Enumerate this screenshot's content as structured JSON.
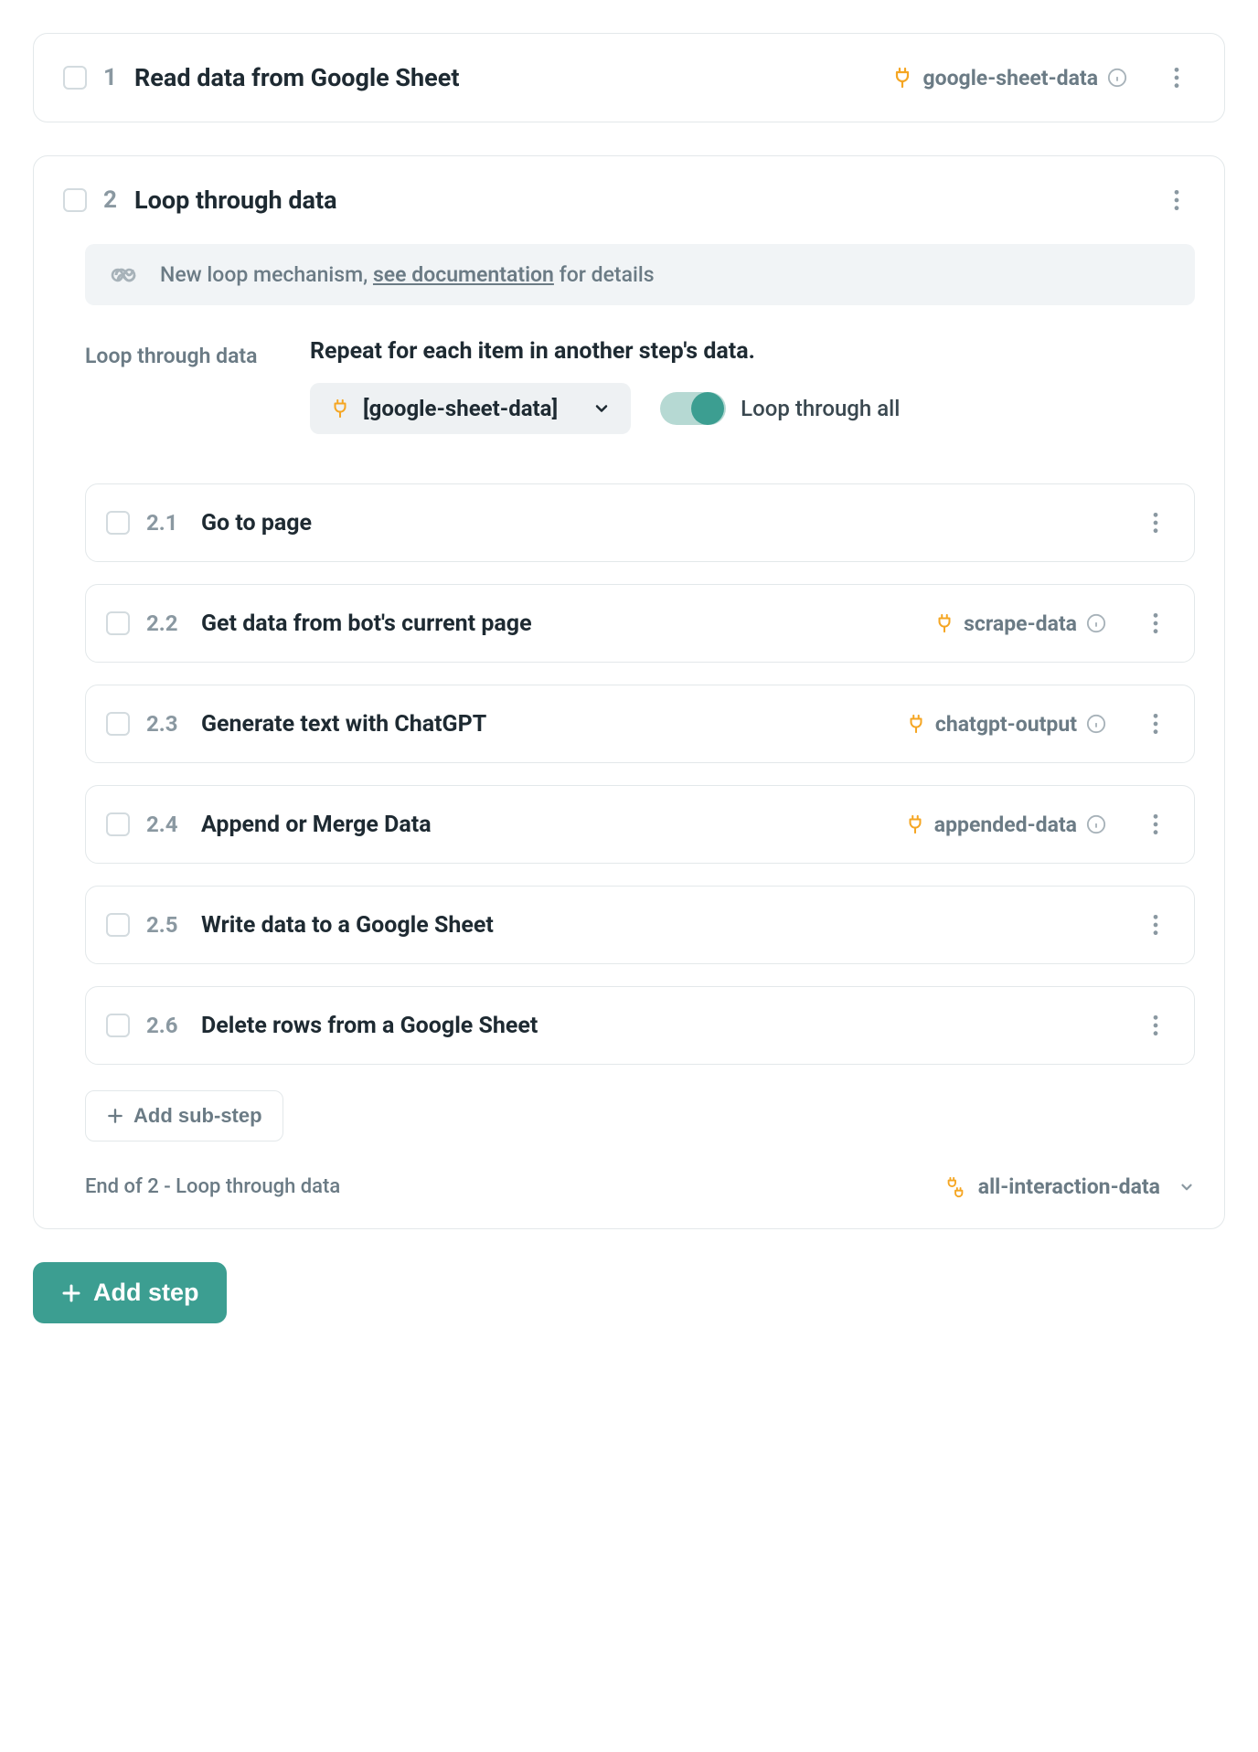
{
  "step1": {
    "number": "1",
    "title": "Read data from Google Sheet",
    "output": "google-sheet-data"
  },
  "loop": {
    "number": "2",
    "title": "Loop through data",
    "notice_prefix": "New loop mechanism, ",
    "notice_link": "see documentation",
    "notice_suffix": " for details",
    "config_label": "Loop through data",
    "config_heading": "Repeat for each item in another step's data.",
    "select_value": "[google-sheet-data]",
    "toggle_label": "Loop through all",
    "substeps": [
      {
        "number": "2.1",
        "title": "Go to page",
        "output": null
      },
      {
        "number": "2.2",
        "title": "Get data from bot's current page",
        "output": "scrape-data"
      },
      {
        "number": "2.3",
        "title": "Generate text with ChatGPT",
        "output": "chatgpt-output"
      },
      {
        "number": "2.4",
        "title": "Append or Merge Data",
        "output": "appended-data"
      },
      {
        "number": "2.5",
        "title": "Write data to a Google Sheet",
        "output": null
      },
      {
        "number": "2.6",
        "title": "Delete rows from a Google Sheet",
        "output": null
      }
    ],
    "add_substep_label": "Add sub-step",
    "footer_text": "End of 2 - Loop through data",
    "footer_output": "all-interaction-data"
  },
  "add_step_label": "Add step"
}
